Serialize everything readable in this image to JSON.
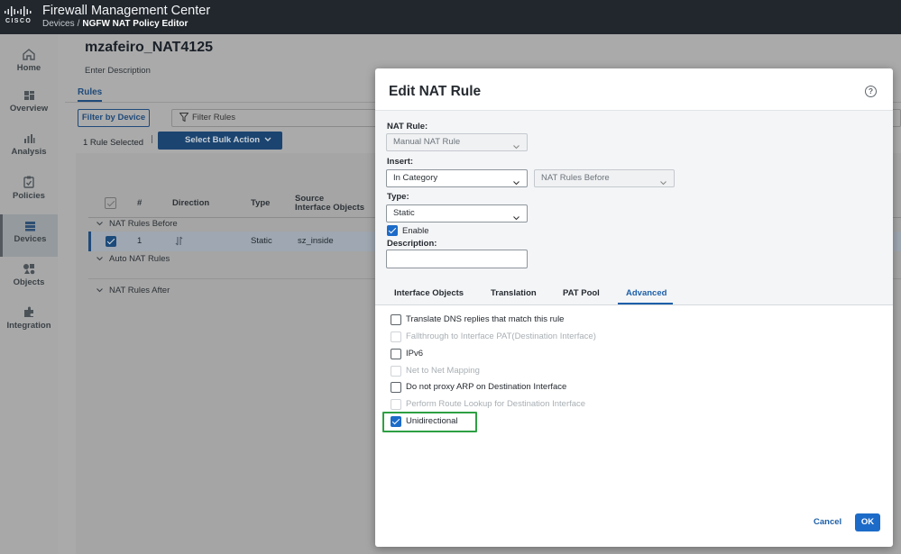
{
  "header": {
    "logo_text": "CISCO",
    "app_title": "Firewall Management Center",
    "breadcrumb": {
      "parent": "Devices",
      "separator": "/",
      "current": "NGFW NAT Policy Editor"
    }
  },
  "sidebar": {
    "items": [
      {
        "label": "Home",
        "icon": "home-icon"
      },
      {
        "label": "Overview",
        "icon": "overview-icon"
      },
      {
        "label": "Analysis",
        "icon": "analysis-icon"
      },
      {
        "label": "Policies",
        "icon": "policies-icon"
      },
      {
        "label": "Devices",
        "icon": "devices-icon",
        "active": true
      },
      {
        "label": "Objects",
        "icon": "objects-icon"
      },
      {
        "label": "Integration",
        "icon": "integration-icon"
      }
    ]
  },
  "policy": {
    "name": "mzafeiro_NAT4125",
    "description": "Enter Description",
    "tab": "Rules",
    "filter_by_device": "Filter by Device",
    "filter_placeholder": "Filter Rules",
    "rule_selected": "1 Rule Selected",
    "bulk_action": "Select Bulk Action",
    "columns": [
      "#",
      "Direction",
      "Type",
      "Source",
      "Interface Objects"
    ],
    "categories": [
      "NAT Rules Before",
      "Auto NAT Rules",
      "NAT Rules After"
    ],
    "rows": [
      {
        "num": "1",
        "direction_icon": "bidirectional-arrows-icon",
        "type": "Static",
        "source_interface": "sz_inside"
      }
    ]
  },
  "modal": {
    "title": "Edit NAT Rule",
    "nat_rule_label": "NAT Rule:",
    "nat_rule_value": "Manual NAT Rule",
    "insert_label": "Insert:",
    "insert_value": "In Category",
    "insert_position": "NAT Rules Before",
    "type_label": "Type:",
    "type_value": "Static",
    "enable_label": "Enable",
    "enable_checked": true,
    "description_label": "Description:",
    "description_value": "",
    "tabs": [
      "Interface Objects",
      "Translation",
      "PAT Pool",
      "Advanced"
    ],
    "active_tab": "Advanced",
    "options": [
      {
        "label": "Translate DNS replies that match this rule",
        "checked": false,
        "disabled": false
      },
      {
        "label": "Fallthrough to Interface PAT(Destination Interface)",
        "checked": false,
        "disabled": true
      },
      {
        "label": "IPv6",
        "checked": false,
        "disabled": false
      },
      {
        "label": "Net to Net Mapping",
        "checked": false,
        "disabled": true
      },
      {
        "label": "Do not proxy ARP on Destination Interface",
        "checked": false,
        "disabled": false
      },
      {
        "label": "Perform Route Lookup for Destination Interface",
        "checked": false,
        "disabled": true
      },
      {
        "label": "Unidirectional",
        "checked": true,
        "disabled": false
      }
    ],
    "highlight_color": "#2ea043",
    "cancel_label": "Cancel",
    "ok_label": "OK"
  },
  "colors": {
    "topbar": "#22272d",
    "primary": "#1d6bc8",
    "primary_dark": "#1f4a7a",
    "overlay": "#aaaaaa"
  }
}
